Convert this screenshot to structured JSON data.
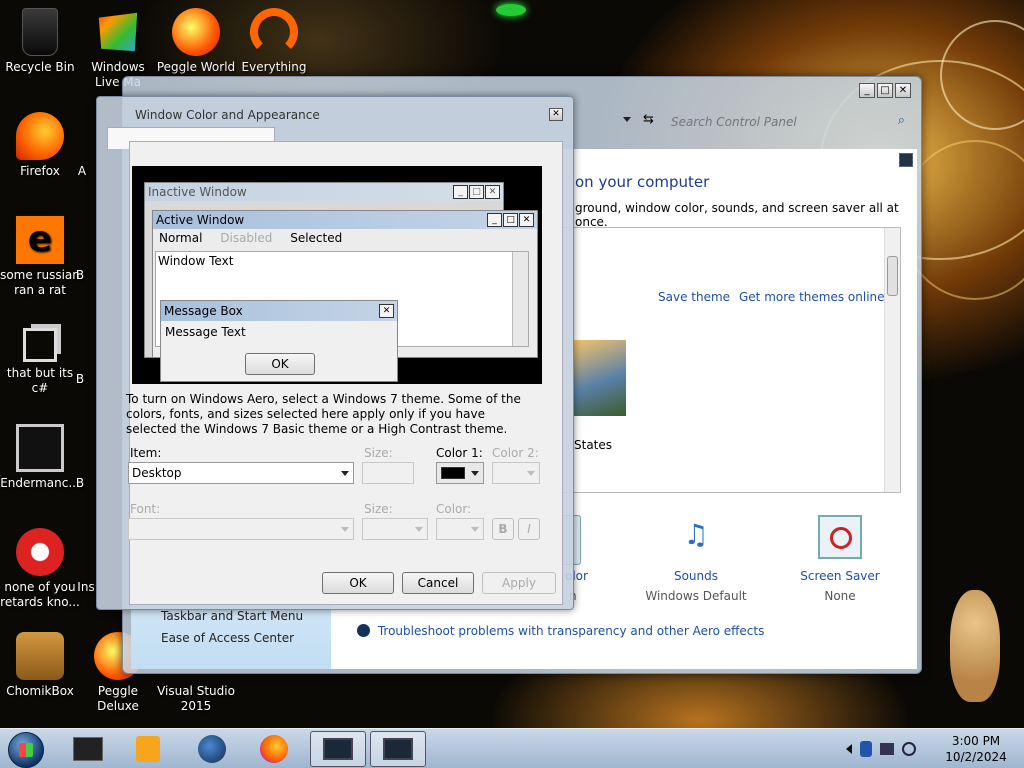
{
  "desktop_icons": [
    {
      "label": "Recycle Bin",
      "icon": "recycle-bin-icon"
    },
    {
      "label": "Windows Live Ma",
      "icon": "windows-live-icon"
    },
    {
      "label": "Peggle World",
      "icon": "peggle-icon"
    },
    {
      "label": "Everything",
      "icon": "everything-icon"
    },
    {
      "label": "Firefox",
      "icon": "firefox-icon"
    },
    {
      "label": "some russian ran a rat",
      "icon": "orange-e-icon"
    },
    {
      "label": "that but its c#",
      "icon": "shortcut-icon"
    },
    {
      "label": "Endermanc...",
      "icon": "monitor-icon"
    },
    {
      "label": "none of you retards kno...",
      "icon": "chrome-icon"
    },
    {
      "label": "ChomikBox",
      "icon": "chomikbox-icon"
    },
    {
      "label": "Peggle Deluxe",
      "icon": "peggle-deluxe-icon"
    },
    {
      "label": "Visual Studio 2015",
      "icon": "visual-studio-icon"
    }
  ],
  "partial_labels": {
    "col2_a": "A",
    "col2_b": "B",
    "col2_c": "B",
    "col2_d": "B",
    "col2_e": "Ins"
  },
  "control_panel": {
    "search_placeholder": "Search Control Panel",
    "heading": "on your computer",
    "subheading": "ground, window color, sounds, and screen saver all at once.",
    "save_theme": "Save theme",
    "get_more_themes": "Get more themes online",
    "theme_states": "States",
    "color_partial": "olor",
    "color_sub_partial": "n",
    "sounds_label": "Sounds",
    "sounds_value": "Windows Default",
    "screensaver_label": "Screen Saver",
    "screensaver_value": "None",
    "see_also": [
      "Taskbar and Start Menu",
      "Ease of Access Center"
    ],
    "troubleshoot": "Troubleshoot problems with transparency and other Aero effects"
  },
  "dialog": {
    "title": "Window Color and Appearance",
    "preview": {
      "inactive_title": "Inactive Window",
      "active_title": "Active Window",
      "menu_normal": "Normal",
      "menu_disabled": "Disabled",
      "menu_selected": "Selected",
      "window_text": "Window Text",
      "msgbox_title": "Message Box",
      "msgbox_text": "Message Text",
      "msgbox_ok": "OK"
    },
    "description": "To turn on Windows Aero, select a Windows 7 theme.  Some of the colors, fonts, and sizes selected here apply only if you have selected the Windows 7 Basic theme or a High Contrast theme.",
    "item_label": "Item:",
    "item_value": "Desktop",
    "size_label": "Size:",
    "color1_label": "Color 1:",
    "color2_label": "Color 2:",
    "font_label": "Font:",
    "font_size_label": "Size:",
    "font_color_label": "Color:",
    "bold_label": "B",
    "italic_label": "I",
    "ok": "OK",
    "cancel": "Cancel",
    "apply": "Apply",
    "color1_value": "#000000"
  },
  "taskbar": {
    "time": "3:00 PM",
    "date": "10/2/2024"
  }
}
